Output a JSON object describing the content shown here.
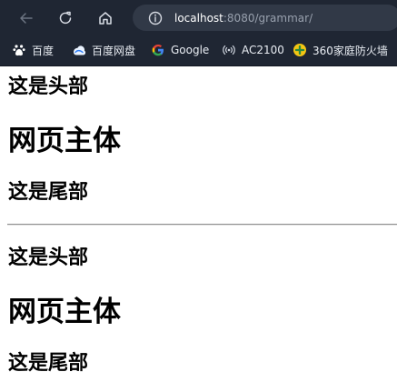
{
  "browser": {
    "address_bar": {
      "url_host": "localhost",
      "url_rest": ":8080/grammar/"
    },
    "bookmarks": [
      {
        "label": "百度",
        "icon": "baidu-paw-icon"
      },
      {
        "label": "百度网盘",
        "icon": "baidu-pan-icon"
      },
      {
        "label": "Google",
        "icon": "google-g-icon"
      },
      {
        "label": "AC2100",
        "icon": "signal-icon"
      },
      {
        "label": "360家庭防火墙",
        "icon": "shield-plus-icon"
      }
    ]
  },
  "page": {
    "sections": [
      {
        "header": "这是头部",
        "body": "网页主体",
        "footer": "这是尾部"
      },
      {
        "header": "这是头部",
        "body": "网页主体",
        "footer": "这是尾部"
      }
    ]
  }
}
